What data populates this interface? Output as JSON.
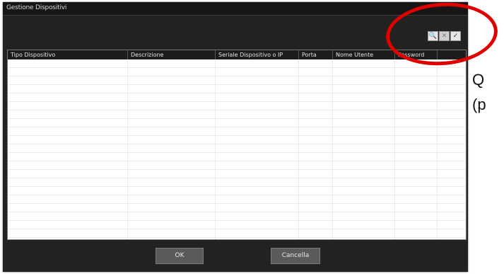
{
  "window": {
    "title": "Gestione Dispositivi"
  },
  "toolbar": {
    "search_icon": "🔍",
    "clear_icon": "✕",
    "confirm_icon": "✓"
  },
  "table": {
    "columns": [
      "Tipo Dispositivo",
      "Descrizione",
      "Seriale Dispositivo o IP",
      "Porta",
      "Nome Utente",
      "Password"
    ],
    "row_count": 22
  },
  "buttons": {
    "ok": "OK",
    "cancel": "Cancella"
  },
  "side_text": {
    "line1": "Q",
    "line2": "(p"
  },
  "colors": {
    "highlight": "#e00000",
    "window_bg": "#222222"
  }
}
